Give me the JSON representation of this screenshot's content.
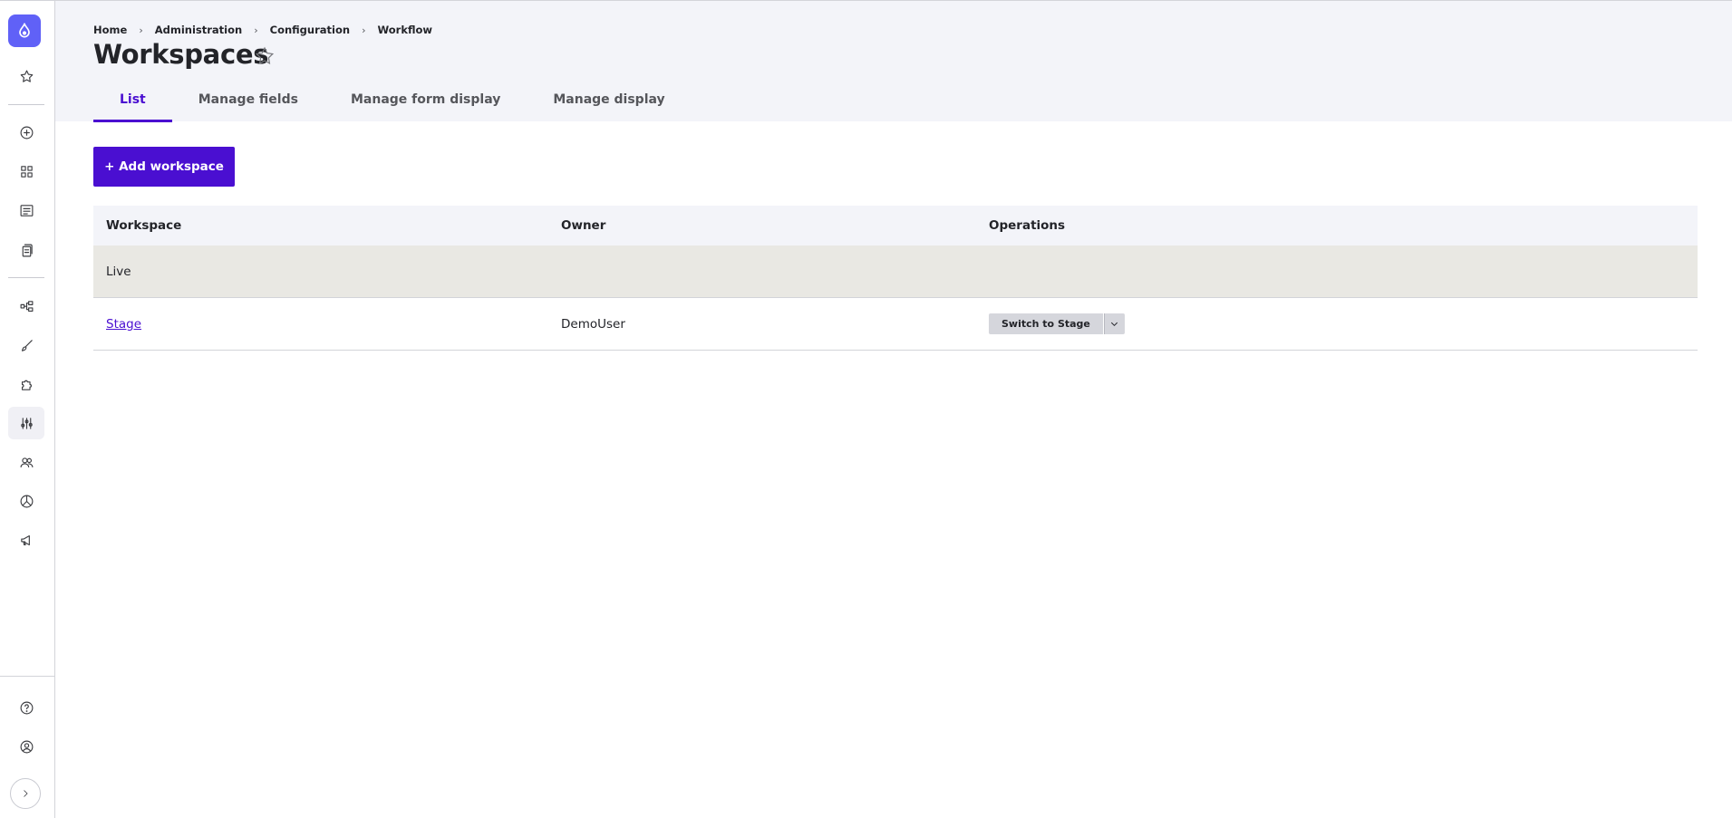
{
  "breadcrumb": {
    "items": [
      "Home",
      "Administration",
      "Configuration",
      "Workflow"
    ],
    "separator": "›"
  },
  "page": {
    "title": "Workspaces"
  },
  "tabs": [
    {
      "label": "List",
      "active": true
    },
    {
      "label": "Manage fields",
      "active": false
    },
    {
      "label": "Manage form display",
      "active": false
    },
    {
      "label": "Manage display",
      "active": false
    }
  ],
  "actions": {
    "add_label": "+ Add workspace"
  },
  "table": {
    "columns": [
      "Workspace",
      "Owner",
      "Operations"
    ],
    "rows": [
      {
        "workspace": "Live",
        "owner": "",
        "operation": ""
      },
      {
        "workspace": "Stage",
        "owner": "DemoUser",
        "operation": "Switch to Stage"
      }
    ]
  },
  "sidebar": {
    "icons": [
      "drupal-logo-icon",
      "star-icon",
      "plus-circle-icon",
      "grid-icon",
      "content-icon",
      "files-icon",
      "structure-icon",
      "brush-icon",
      "puzzle-icon",
      "sliders-icon",
      "people-icon",
      "reports-icon",
      "megaphone-icon",
      "help-icon",
      "user-icon",
      "chevron-right-icon"
    ]
  },
  "colors": {
    "accent": "#4a0fd1",
    "logo": "#6061f7",
    "header_bg": "#f3f4f9",
    "live_row_bg": "#e9e8e3"
  }
}
